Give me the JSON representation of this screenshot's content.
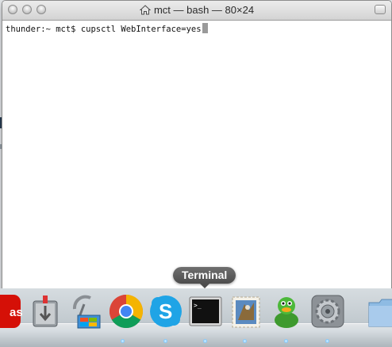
{
  "window": {
    "title": "mct — bash — 80×24",
    "terminal_line": "thunder:~ mct$ cupsctl WebInterface=yes"
  },
  "dock": {
    "tooltip": "Terminal",
    "items": [
      {
        "name": "lastfm-icon"
      },
      {
        "name": "archive-utility-icon"
      },
      {
        "name": "wireless-diagnostics-icon"
      },
      {
        "name": "chrome-icon"
      },
      {
        "name": "skype-icon"
      },
      {
        "name": "terminal-icon"
      },
      {
        "name": "mail-stamp-icon"
      },
      {
        "name": "adium-duck-icon"
      },
      {
        "name": "system-preferences-icon"
      },
      {
        "name": "folder-icon"
      }
    ]
  }
}
